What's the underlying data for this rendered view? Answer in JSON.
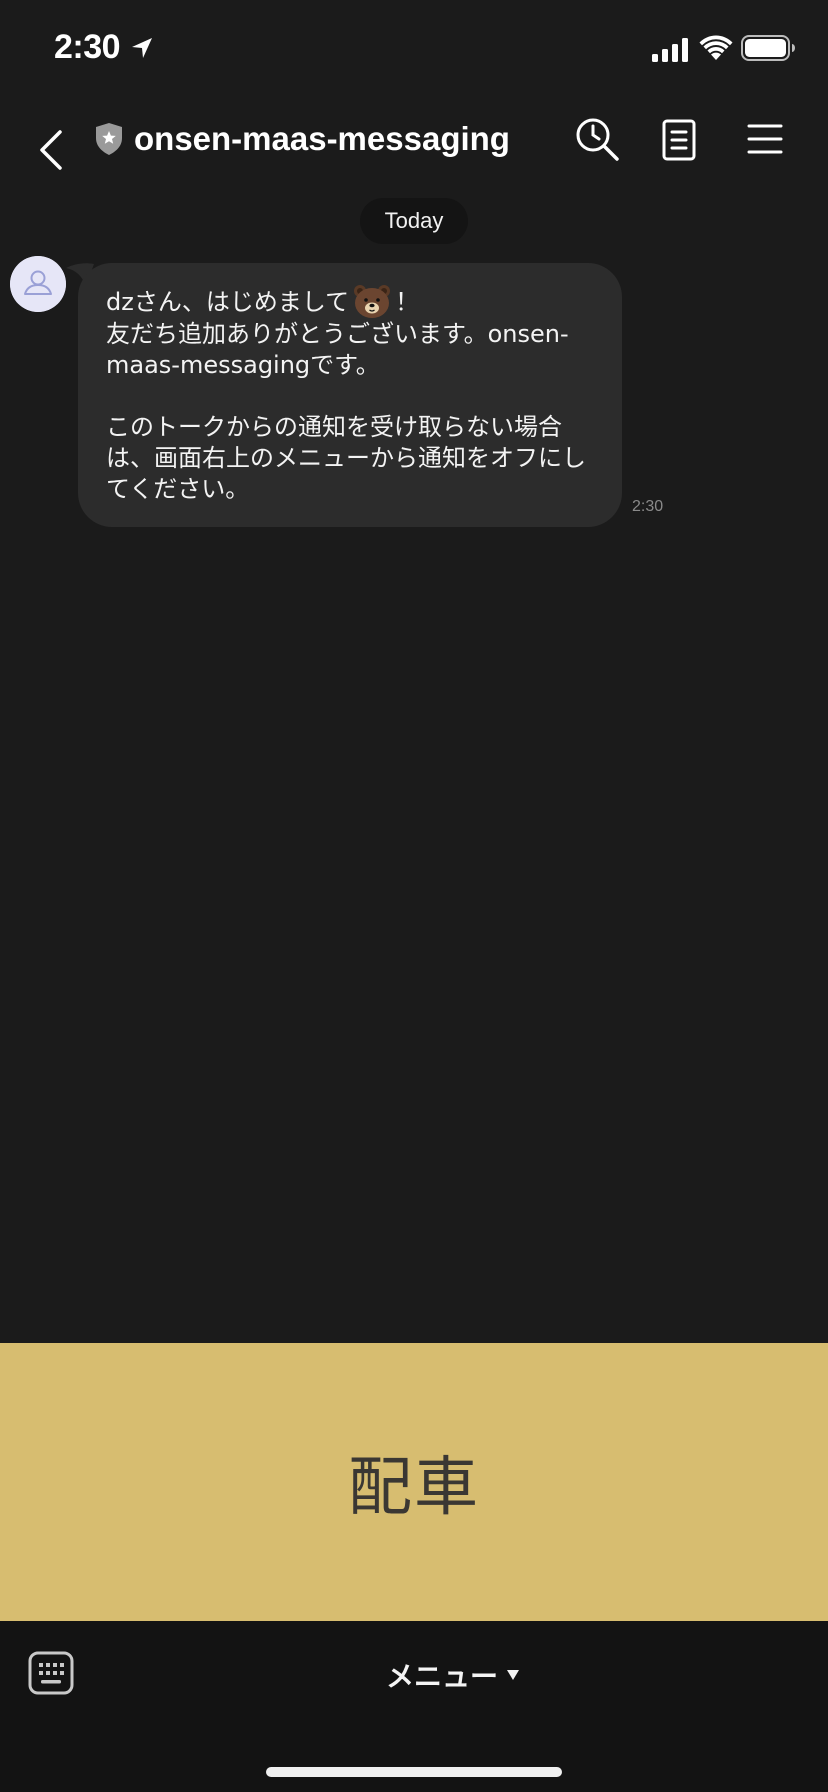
{
  "status_bar": {
    "time": "2:30"
  },
  "header": {
    "title": "onsen-maas-messaging"
  },
  "chat": {
    "date_label": "Today",
    "messages": [
      {
        "line1_before_emoji": "dzさん、はじめまして",
        "line1_after_emoji": "！",
        "emoji": "brown-bear-emoji",
        "lines": [
          "友だち追加ありがとうございます。onsen-",
          "maas-messagingです。",
          "",
          "このトークからの通知を受け取らない場合",
          "は、画面右上のメニューから通知をオフにし",
          "てください。"
        ],
        "time": "2:30"
      }
    ]
  },
  "rich_menu": {
    "label": "配車",
    "background": "#d7bd70"
  },
  "bottom_bar": {
    "menu_label": "メニュー"
  },
  "icons": {
    "back": "chevron-left-icon",
    "official": "shield-star-icon",
    "search": "clock-search-icon",
    "notes": "note-icon",
    "menu": "hamburger-icon",
    "keyboard": "keyboard-icon"
  }
}
